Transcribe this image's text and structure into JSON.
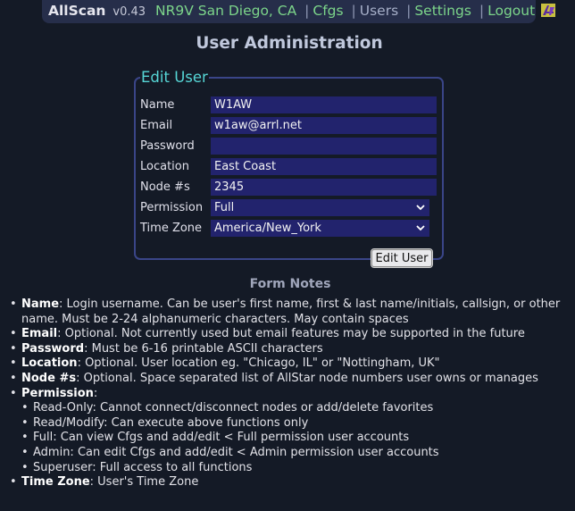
{
  "header": {
    "app_name": "AllScan",
    "version": "v0.43",
    "callsign_location": "NR9V San Diego, CA",
    "separator": "|",
    "nav": [
      {
        "label": "Cfgs"
      },
      {
        "label": "Users"
      },
      {
        "label": "Settings"
      },
      {
        "label": "Logout"
      }
    ],
    "logo_icon": "allstar-logo-icon"
  },
  "page_title": "User Administration",
  "form": {
    "legend": "Edit User",
    "fields": [
      {
        "label": "Name",
        "value": "W1AW"
      },
      {
        "label": "Email",
        "value": "w1aw@arrl.net"
      },
      {
        "label": "Password",
        "value": ""
      },
      {
        "label": "Location",
        "value": "East Coast"
      },
      {
        "label": "Node #s",
        "value": "2345"
      },
      {
        "label": "Permission",
        "value": "Full"
      },
      {
        "label": "Time Zone",
        "value": "America/New_York"
      }
    ],
    "submit_label": "Edit User"
  },
  "notes": {
    "title": "Form Notes",
    "items": [
      {
        "term": "Name",
        "text": ": Login username. Can be user's first name, first & last name/initials, callsign, or other name. Must be 2-24 alphanumeric characters. May contain spaces"
      },
      {
        "term": "Email",
        "text": ": Optional. Not currently used but email features may be supported in the future"
      },
      {
        "term": "Password",
        "text": ": Must be 6-16 printable ASCII characters"
      },
      {
        "term": "Location",
        "text": ": Optional. User location eg. \"Chicago, IL\" or \"Nottingham, UK\""
      },
      {
        "term": "Node #s",
        "text": ": Optional. Space separated list of AllStar node numbers user owns or manages"
      },
      {
        "term": "Permission",
        "text": ":"
      },
      {
        "term": "Time Zone",
        "text": ": User's Time Zone"
      }
    ],
    "permission_levels": [
      "Read-Only: Cannot connect/disconnect nodes or add/delete favorites",
      "Read/Modify: Can execute above functions only",
      "Full: Can view Cfgs and add/edit < Full permission user accounts",
      "Admin: Can edit Cfgs and add/edit < Admin permission user accounts",
      "Superuser: Full access to all functions"
    ]
  },
  "colors": {
    "background": "#141a26",
    "header_bg": "#262e4a",
    "link_green": "#7cd58a",
    "legend_cyan": "#56d6d6",
    "input_bg": "#22236d",
    "fieldset_border": "#3a4588"
  }
}
